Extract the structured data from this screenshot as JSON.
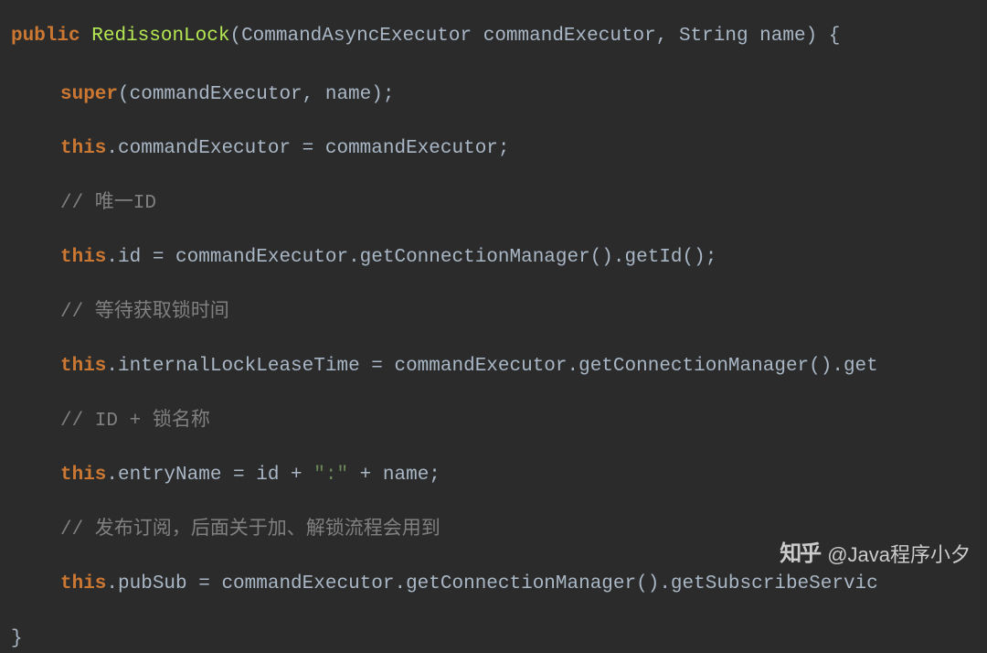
{
  "code": {
    "keyword_public": "public",
    "method_name": "RedissonLock",
    "signature_rest": "(CommandAsyncExecutor commandExecutor, String name) {",
    "keyword_super": "super",
    "super_args": "(commandExecutor, name);",
    "keyword_this": "this",
    "assign_cmdExec": ".commandExecutor = commandExecutor;",
    "comment1": "// 唯一ID",
    "assign_id": ".id = commandExecutor.getConnectionManager().getId();",
    "comment2": "// 等待获取锁时间",
    "assign_lockLease": ".internalLockLeaseTime = commandExecutor.getConnectionManager().get",
    "comment3": "// ID + 锁名称",
    "assign_entry_pre": ".entryName = id + ",
    "string_colon": "\":\"",
    "assign_entry_post": " + name;",
    "comment4": "// 发布订阅，后面关于加、解锁流程会用到",
    "assign_pubsub": ".pubSub = commandExecutor.getConnectionManager().getSubscribeServic",
    "close_brace": "}"
  },
  "watermark": {
    "logo": "知乎",
    "text": "@Java程序小夕"
  }
}
